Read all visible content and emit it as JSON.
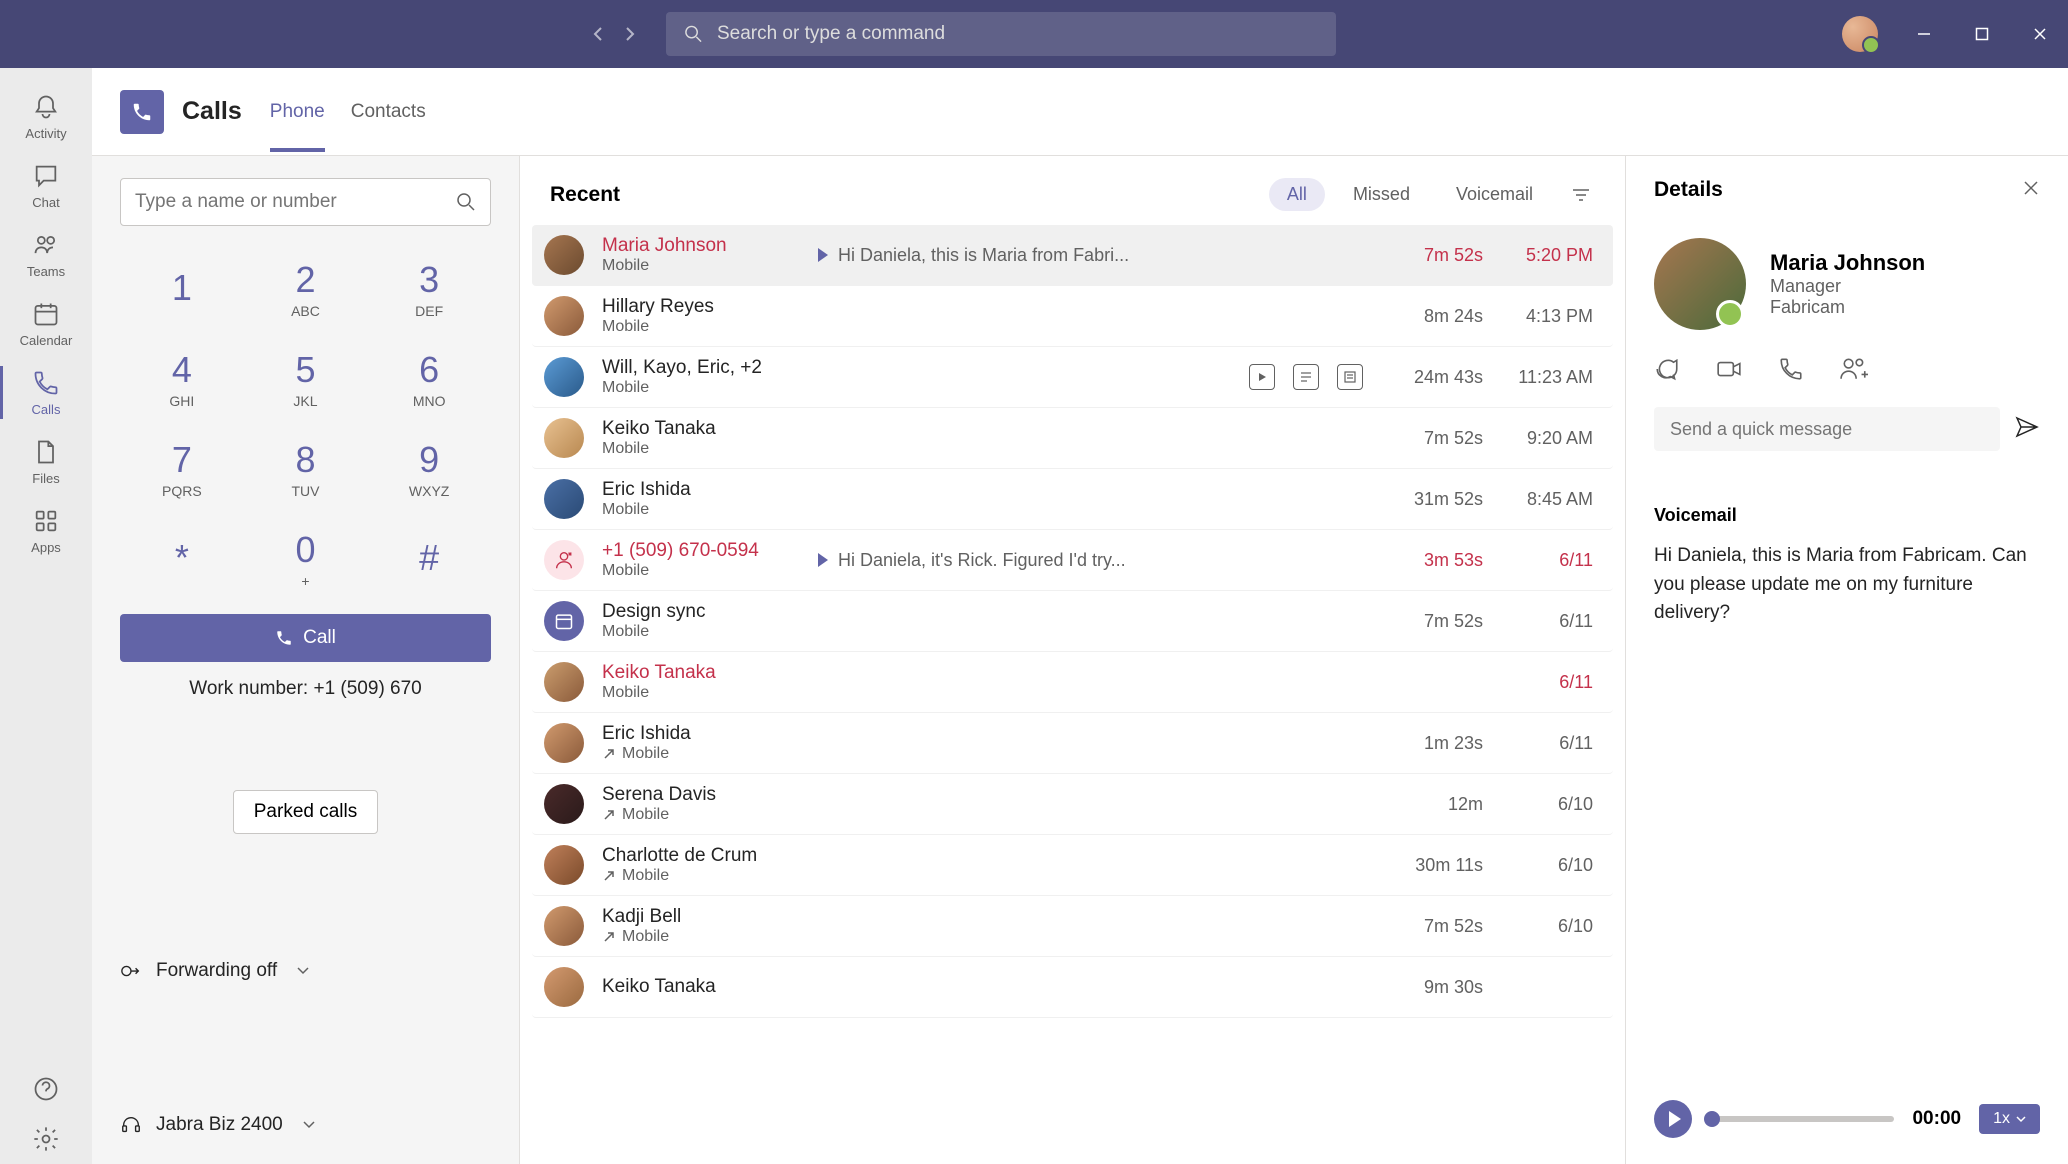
{
  "search_placeholder": "Search or type a command",
  "rail": [
    {
      "icon": "bell",
      "label": "Activity"
    },
    {
      "icon": "chat",
      "label": "Chat"
    },
    {
      "icon": "teams",
      "label": "Teams"
    },
    {
      "icon": "calendar",
      "label": "Calendar"
    },
    {
      "icon": "call",
      "label": "Calls",
      "active": true
    },
    {
      "icon": "file",
      "label": "Files"
    },
    {
      "icon": "apps",
      "label": "Apps"
    }
  ],
  "header": {
    "title": "Calls",
    "tabs": [
      "Phone",
      "Contacts"
    ],
    "active_tab": 0
  },
  "dialer": {
    "placeholder": "Type a name or number",
    "keys": [
      {
        "d": "1",
        "l": ""
      },
      {
        "d": "2",
        "l": "ABC"
      },
      {
        "d": "3",
        "l": "DEF"
      },
      {
        "d": "4",
        "l": "GHI"
      },
      {
        "d": "5",
        "l": "JKL"
      },
      {
        "d": "6",
        "l": "MNO"
      },
      {
        "d": "7",
        "l": "PQRS"
      },
      {
        "d": "8",
        "l": "TUV"
      },
      {
        "d": "9",
        "l": "WXYZ"
      },
      {
        "d": "*",
        "l": ""
      },
      {
        "d": "0",
        "l": "+"
      },
      {
        "d": "#",
        "l": ""
      }
    ],
    "call_label": "Call",
    "work_number": "Work number: +1 (509) 670",
    "parked_label": "Parked calls",
    "forwarding": "Forwarding off",
    "device": "Jabra Biz 2400"
  },
  "recent": {
    "title": "Recent",
    "filters": [
      "All",
      "Missed",
      "Voicemail"
    ],
    "active_filter": 0,
    "rows": [
      {
        "name": "Maria Johnson",
        "sub": "Mobile",
        "preview": "Hi Daniela, this is Maria from Fabri...",
        "play": true,
        "dur": "7m 52s",
        "time": "5:20 PM",
        "missed": true,
        "selected": true,
        "av": 1
      },
      {
        "name": "Hillary Reyes",
        "sub": "Mobile",
        "dur": "8m 24s",
        "time": "4:13 PM",
        "av": 2
      },
      {
        "name": "Will, Kayo, Eric, +2",
        "sub": "Mobile",
        "icons": true,
        "dur": "24m 43s",
        "time": "11:23 AM",
        "av": 3,
        "multi": true
      },
      {
        "name": "Keiko Tanaka",
        "sub": "Mobile",
        "dur": "7m 52s",
        "time": "9:20 AM",
        "av": 4
      },
      {
        "name": "Eric Ishida",
        "sub": "Mobile",
        "dur": "31m 52s",
        "time": "8:45 AM",
        "av": 5
      },
      {
        "name": "+1 (509) 670-0594",
        "sub": "Mobile",
        "preview": "Hi Daniela, it's Rick. Figured I'd try...",
        "play": true,
        "dur": "3m 53s",
        "time": "6/11",
        "missed": true,
        "av": 6,
        "icon_av": "vm"
      },
      {
        "name": "Design sync",
        "sub": "Mobile",
        "dur": "7m 52s",
        "time": "6/11",
        "av": 7,
        "icon_av": "cal"
      },
      {
        "name": "Keiko Tanaka",
        "sub": "Mobile",
        "dur": "",
        "time": "6/11",
        "missed": true,
        "av": 8
      },
      {
        "name": "Eric Ishida",
        "sub": "Mobile",
        "out": true,
        "dur": "1m 23s",
        "time": "6/11",
        "av": 9
      },
      {
        "name": "Serena Davis",
        "sub": "Mobile",
        "out": true,
        "dur": "12m",
        "time": "6/10",
        "av": 10
      },
      {
        "name": "Charlotte de Crum",
        "sub": "Mobile",
        "out": true,
        "dur": "30m 11s",
        "time": "6/10",
        "av": 11
      },
      {
        "name": "Kadji Bell",
        "sub": "Mobile",
        "out": true,
        "dur": "7m 52s",
        "time": "6/10",
        "av": 12
      },
      {
        "name": "Keiko Tanaka",
        "sub": "",
        "dur": "9m 30s",
        "time": "",
        "av": 13
      }
    ]
  },
  "details": {
    "title": "Details",
    "name": "Maria Johnson",
    "role": "Manager",
    "company": "Fabricam",
    "quick_msg_placeholder": "Send a quick message",
    "vm_title": "Voicemail",
    "vm_text": "Hi Daniela, this is Maria from Fabricam. Can you please update me on my furniture delivery?",
    "time": "00:00",
    "speed": "1x"
  }
}
